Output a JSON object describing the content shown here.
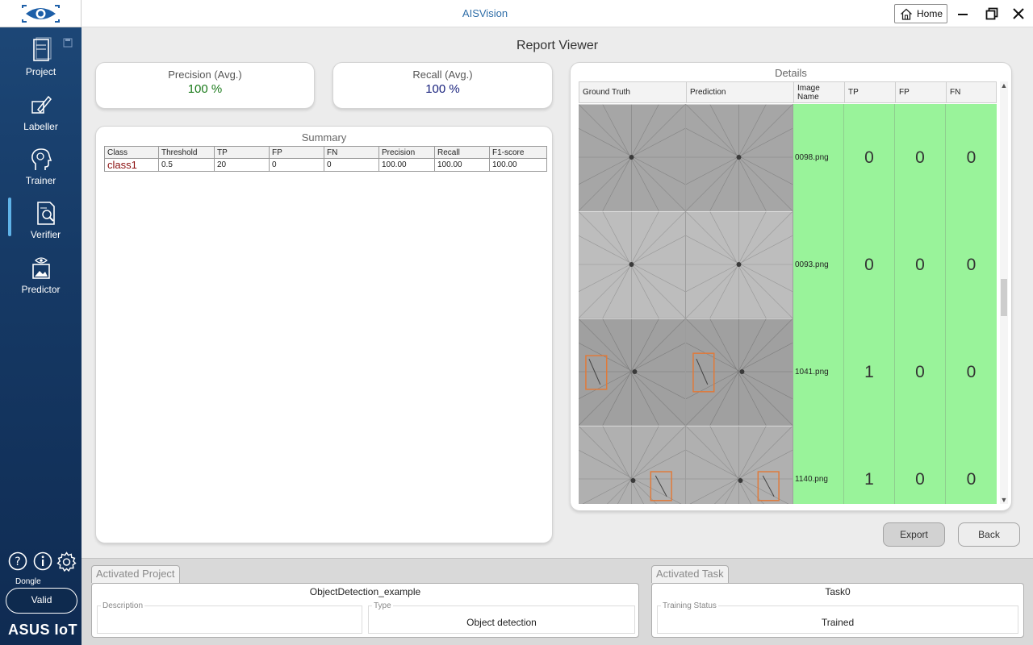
{
  "app": {
    "title": "AISVision"
  },
  "titlebar": {
    "home_label": "Home"
  },
  "sidebar": {
    "items": [
      {
        "label": "Project",
        "icon": "project-icon"
      },
      {
        "label": "Labeller",
        "icon": "labeller-icon"
      },
      {
        "label": "Trainer",
        "icon": "trainer-icon"
      },
      {
        "label": "Verifier",
        "icon": "verifier-icon"
      },
      {
        "label": "Predictor",
        "icon": "predictor-icon"
      }
    ],
    "active": "Verifier",
    "dongle_label": "Dongle",
    "dongle_status": "Valid",
    "brand": "ASUS IoT"
  },
  "page": {
    "title": "Report Viewer"
  },
  "metrics": {
    "precision": {
      "label": "Precision (Avg.)",
      "value": "100 %",
      "color": "#1a7a1a"
    },
    "recall": {
      "label": "Recall (Avg.)",
      "value": "100 %",
      "color": "#1a237e"
    }
  },
  "summary": {
    "title": "Summary",
    "columns": [
      "Class",
      "Threshold",
      "TP",
      "FP",
      "FN",
      "Precision",
      "Recall",
      "F1-score"
    ],
    "rows": [
      [
        "class1",
        "0.5",
        "20",
        "0",
        "0",
        "100.00",
        "100.00",
        "100.00"
      ]
    ]
  },
  "details": {
    "title": "Details",
    "columns": [
      "Ground Truth",
      "Prediction",
      "Image Name",
      "TP",
      "FP",
      "FN"
    ],
    "rows": [
      {
        "image": "0098.png",
        "tp": "0",
        "fp": "0",
        "fn": "0"
      },
      {
        "image": "0093.png",
        "tp": "0",
        "fp": "0",
        "fn": "0"
      },
      {
        "image": "1041.png",
        "tp": "1",
        "fp": "0",
        "fn": "0"
      },
      {
        "image": "1140.png",
        "tp": "1",
        "fp": "0",
        "fn": "0"
      }
    ],
    "row_color": "#99f39a"
  },
  "actions": {
    "export_label": "Export",
    "back_label": "Back"
  },
  "activated_project": {
    "tab_label": "Activated Project",
    "name": "ObjectDetection_example",
    "description_label": "Description",
    "description_value": "",
    "type_label": "Type",
    "type_value": "Object detection"
  },
  "activated_task": {
    "tab_label": "Activated Task",
    "name": "Task0",
    "status_label": "Training Status",
    "status_value": "Trained"
  }
}
